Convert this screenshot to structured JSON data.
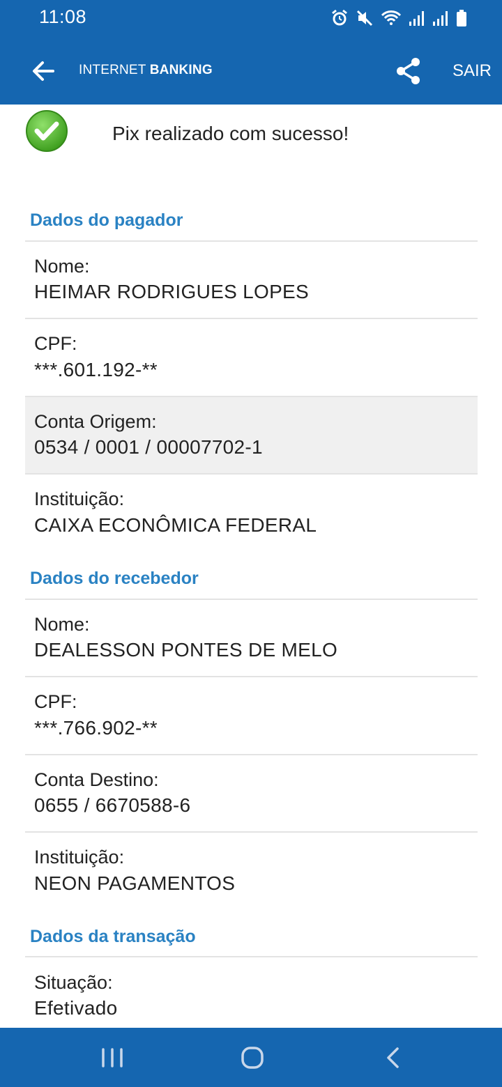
{
  "status_bar": {
    "time": "11:08",
    "icons": [
      "alarm-icon",
      "mute-icon",
      "wifi-icon",
      "signal-icon",
      "signal-icon",
      "battery-icon"
    ]
  },
  "app_bar": {
    "title_light": "INTERNET ",
    "title_bold": "BANKING",
    "exit_label": "SAIR",
    "icons": [
      "back-arrow-icon",
      "share-icon"
    ]
  },
  "success": {
    "message": "Pix realizado com sucesso!",
    "icon": "check-circle-icon",
    "icon_color": "#4caf27"
  },
  "payer": {
    "title": "Dados do pagador",
    "fields": [
      {
        "label": "Nome:",
        "value": "HEIMAR RODRIGUES LOPES"
      },
      {
        "label": "CPF:",
        "value": "***.601.192-**"
      },
      {
        "label": "Conta Origem:",
        "value": "0534 / 0001 / 00007702-1"
      },
      {
        "label": "Instituição:",
        "value": "CAIXA ECONÔMICA FEDERAL"
      }
    ]
  },
  "receiver": {
    "title": "Dados do recebedor",
    "fields": [
      {
        "label": "Nome:",
        "value": "DEALESSON PONTES DE MELO"
      },
      {
        "label": "CPF:",
        "value": "***.766.902-**"
      },
      {
        "label": "Conta Destino:",
        "value": "0655 / 6670588-6"
      },
      {
        "label": "Instituição:",
        "value": "NEON PAGAMENTOS"
      }
    ]
  },
  "transaction": {
    "title": "Dados da transação",
    "fields": [
      {
        "label": "Situação:",
        "value": "Efetivado"
      }
    ]
  },
  "nav_bar": {
    "icons": [
      "recent-apps-icon",
      "home-icon",
      "back-icon"
    ]
  },
  "colors": {
    "primary": "#1566b0",
    "section_title": "#2a82c3",
    "highlight_row": "#f0f0f0"
  }
}
